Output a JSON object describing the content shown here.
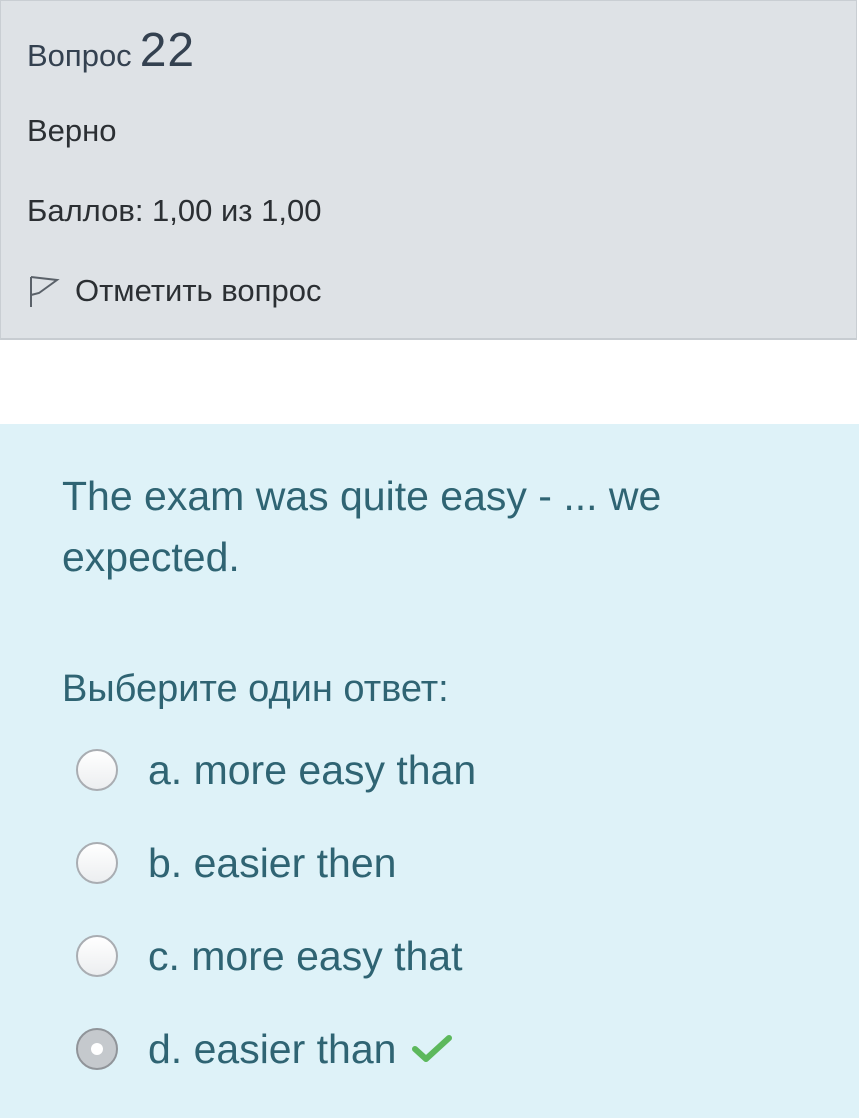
{
  "question_info": {
    "label": "Вопрос",
    "number": "22",
    "state": "Верно",
    "grade": "Баллов: 1,00 из 1,00",
    "flag_label": "Отметить вопрос",
    "flag_icon": "flag-icon"
  },
  "question": {
    "text": "The exam was quite easy -  ... we expected.",
    "prompt": "Выберите один ответ:",
    "answers": [
      {
        "label": "a. more easy than",
        "selected": false
      },
      {
        "label": "b. easier then",
        "selected": false
      },
      {
        "label": "c. more easy that",
        "selected": false
      },
      {
        "label": "d. easier than",
        "selected": true,
        "correct": true
      }
    ]
  },
  "colors": {
    "info_background": "#dee2e6",
    "content_background": "#def2f8",
    "question_text": "#2f6473",
    "correct_check": "#5cb85c"
  }
}
